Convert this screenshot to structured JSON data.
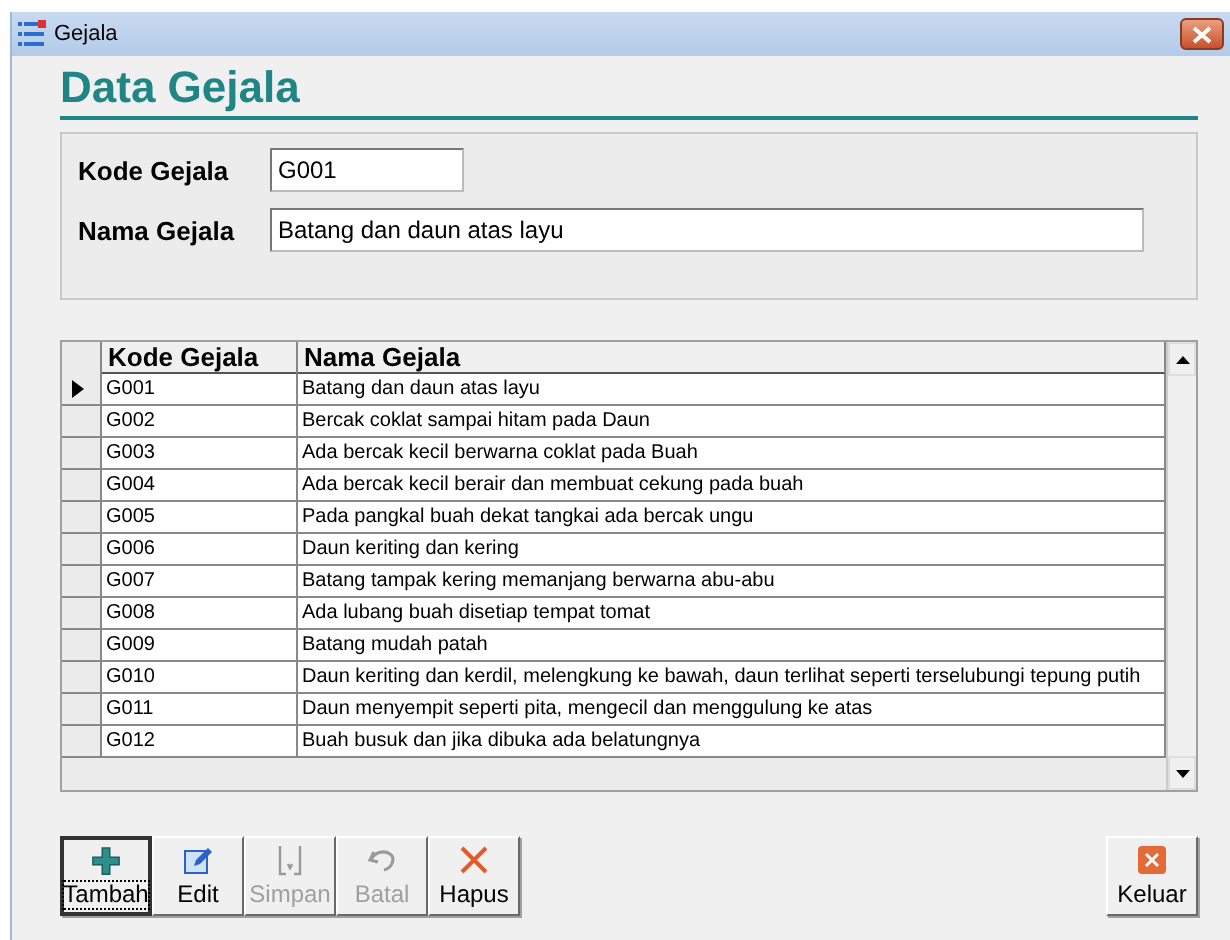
{
  "window": {
    "title": "Gejala"
  },
  "heading": "Data Gejala",
  "form": {
    "fields": [
      {
        "label": "Kode Gejala",
        "value": "G001",
        "kind": "short"
      },
      {
        "label": "Nama Gejala",
        "value": "Batang dan daun atas layu",
        "kind": "long"
      }
    ]
  },
  "table": {
    "columns": [
      "Kode Gejala",
      "Nama Gejala"
    ],
    "rows": [
      {
        "cells": [
          "G001",
          "Batang dan daun atas layu"
        ],
        "selected": true
      },
      {
        "cells": [
          "G002",
          "Bercak coklat sampai hitam pada Daun"
        ],
        "selected": false
      },
      {
        "cells": [
          "G003",
          "Ada bercak kecil berwarna coklat pada Buah"
        ],
        "selected": false
      },
      {
        "cells": [
          "G004",
          "Ada bercak kecil berair dan membuat cekung pada buah"
        ],
        "selected": false
      },
      {
        "cells": [
          "G005",
          "Pada pangkal buah dekat tangkai ada bercak ungu"
        ],
        "selected": false
      },
      {
        "cells": [
          "G006",
          "Daun keriting dan kering"
        ],
        "selected": false
      },
      {
        "cells": [
          "G007",
          "Batang tampak kering memanjang berwarna abu-abu"
        ],
        "selected": false
      },
      {
        "cells": [
          "G008",
          "Ada lubang buah disetiap tempat tomat"
        ],
        "selected": false
      },
      {
        "cells": [
          "G009",
          "Batang mudah patah"
        ],
        "selected": false
      },
      {
        "cells": [
          "G010",
          "Daun keriting dan kerdil, melengkung ke bawah, daun terlihat seperti terselubungi tepung putih"
        ],
        "selected": false
      },
      {
        "cells": [
          "G011",
          "Daun menyempit seperti pita, mengecil dan menggulung ke atas"
        ],
        "selected": false
      },
      {
        "cells": [
          "G012",
          "Buah busuk dan jika dibuka ada belatungnya"
        ],
        "selected": false
      }
    ]
  },
  "buttons": [
    {
      "label": "Tambah",
      "kind": "add",
      "disabled": false,
      "focused": true
    },
    {
      "label": "Edit",
      "kind": "edit",
      "disabled": false,
      "focused": false
    },
    {
      "label": "Simpan",
      "kind": "save",
      "disabled": true,
      "focused": false
    },
    {
      "label": "Batal",
      "kind": "undo",
      "disabled": true,
      "focused": false
    },
    {
      "label": "Hapus",
      "kind": "delete",
      "disabled": false,
      "focused": false
    },
    {
      "label": "Keluar",
      "kind": "exit",
      "disabled": false,
      "focused": false
    }
  ]
}
